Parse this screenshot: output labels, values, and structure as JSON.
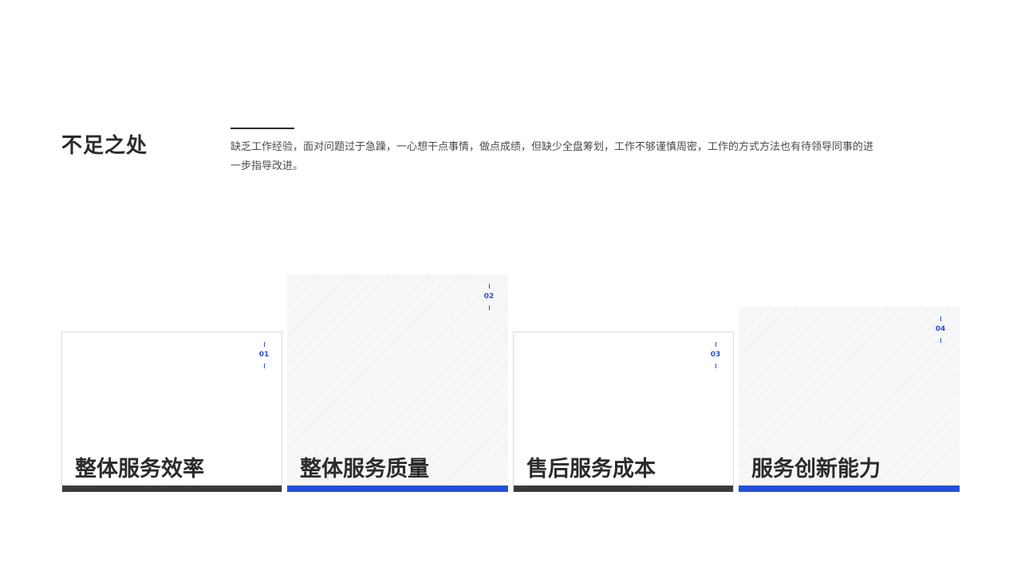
{
  "header": {
    "title": "不足之处",
    "description": "缺乏工作经验，面对问题过于急躁，一心想干点事情，做点成绩，但缺少全盘筹划，工作不够谨慎周密，工作的方式方法也有待领导同事的进一步指导改进。"
  },
  "cards": [
    {
      "number": "01",
      "label": "整体服务效率"
    },
    {
      "number": "02",
      "label": "整体服务质量"
    },
    {
      "number": "03",
      "label": "售后服务成本"
    },
    {
      "number": "04",
      "label": "服务创新能力"
    }
  ],
  "colors": {
    "accent": "#2450d9",
    "dark": "#3a3a3a",
    "text": "#2b2b2b"
  }
}
